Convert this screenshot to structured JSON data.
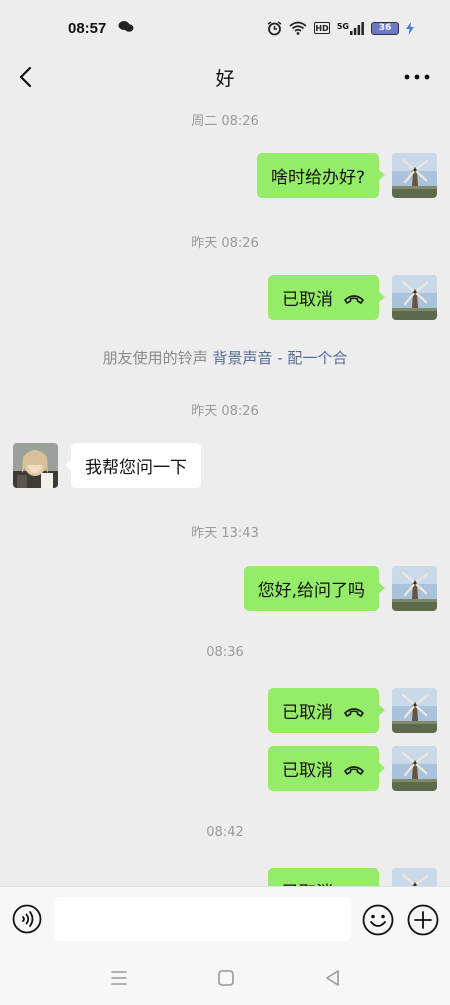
{
  "status_bar": {
    "time": "08:57",
    "network": "5G",
    "battery": "36"
  },
  "header": {
    "title": "好"
  },
  "messages": [
    {
      "type": "time",
      "text": "周二 08:26"
    },
    {
      "type": "me",
      "text": "啥时给办好?"
    },
    {
      "type": "time",
      "text": "昨天 08:26"
    },
    {
      "type": "me-call",
      "text": "已取消"
    },
    {
      "type": "system",
      "text": "朋友使用的铃声",
      "link": "背景声音 - 配一个合"
    },
    {
      "type": "time",
      "text": "昨天 08:26"
    },
    {
      "type": "other",
      "text": "我帮您问一下"
    },
    {
      "type": "time",
      "text": "昨天 13:43"
    },
    {
      "type": "me",
      "text": "您好,给问了吗"
    },
    {
      "type": "time",
      "text": "08:36"
    },
    {
      "type": "me-call",
      "text": "已取消"
    },
    {
      "type": "me-call",
      "text": "已取消"
    },
    {
      "type": "time",
      "text": "08:42"
    },
    {
      "type": "me-call",
      "text": "已取消"
    }
  ],
  "input": {
    "value": "",
    "placeholder": ""
  },
  "icons": {
    "back": "back-arrow-icon",
    "more": "more-dots-icon",
    "voice": "voice-icon",
    "emoji": "emoji-icon",
    "plus": "plus-icon",
    "call": "phone-hangup-icon"
  },
  "colors": {
    "background": "#ededed",
    "my_bubble": "#95ec69",
    "other_bubble": "#ffffff",
    "link": "#576b95"
  }
}
